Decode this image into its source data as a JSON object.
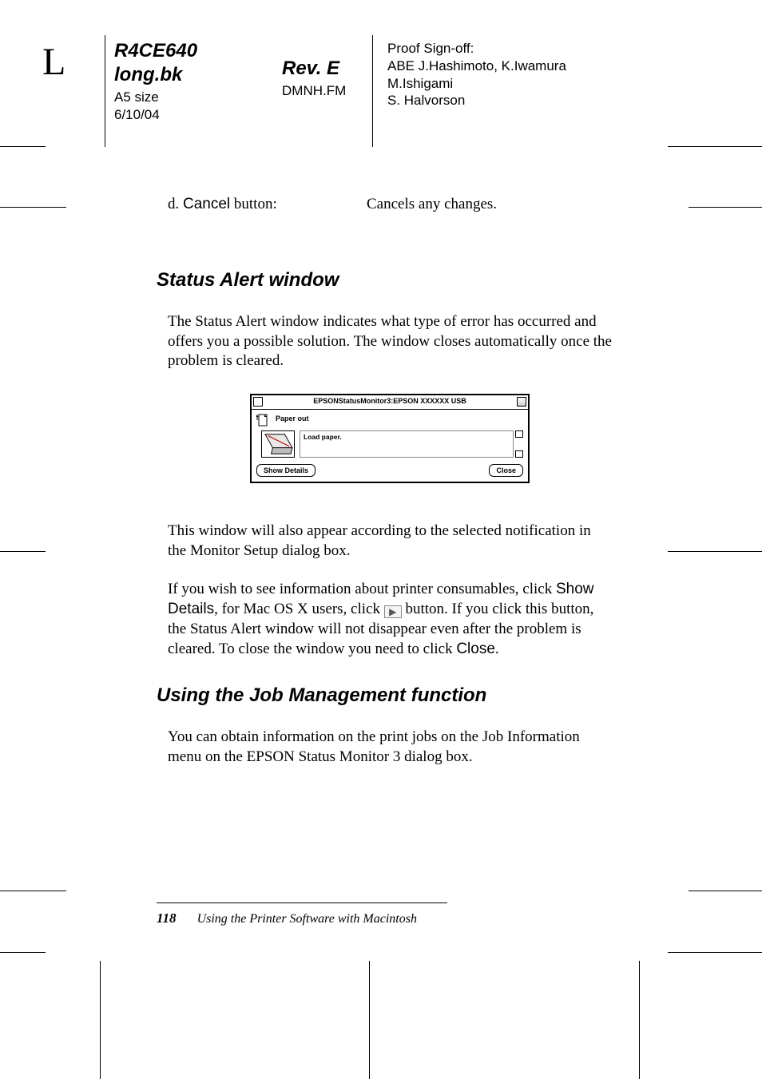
{
  "header": {
    "side_letter": "L",
    "col1": {
      "code": "R4CE640",
      "file": "long.bk",
      "size": "A5 size",
      "date": "6/10/04"
    },
    "col2": {
      "rev": "Rev. E",
      "fm": "DMNH.FM"
    },
    "col3": {
      "l1": "Proof Sign-off:",
      "l2": "ABE J.Hashimoto, K.Iwamura",
      "l3": "M.Ishigami",
      "l4": "S. Halvorson"
    }
  },
  "item_d": {
    "label_prefix": "d.  ",
    "label_button": "Cancel",
    "label_suffix": " button:",
    "value": "Cancels any changes."
  },
  "sec1": {
    "title": "Status Alert window",
    "p1": "The Status Alert window indicates what type of error has occurred and offers you a possible solution. The window closes automatically once the problem is cleared.",
    "p2": "This window will also appear according to the selected notification in the Monitor Setup dialog box.",
    "p3a": "If you wish to see information about printer consumables, click ",
    "p3b_ui": "Show Details",
    "p3c": ", for Mac OS X users, click ",
    "p3d": " button. If you click this button, the Status Alert window will not disappear even after the problem is cleared. To close the window you need to click ",
    "p3e_ui": "Close",
    "p3f": "."
  },
  "shot": {
    "title": "EPSONStatusMonitor3:EPSON XXXXXX  USB",
    "status": "Paper out",
    "message": "Load paper.",
    "btn_details": "Show Details",
    "btn_close": "Close"
  },
  "sec2": {
    "title": "Using the Job Management function",
    "p1": "You can obtain information on the print jobs on the Job Information menu on the EPSON Status Monitor 3 dialog box."
  },
  "footer": {
    "page": "118",
    "chapter": "Using the Printer Software with Macintosh"
  }
}
